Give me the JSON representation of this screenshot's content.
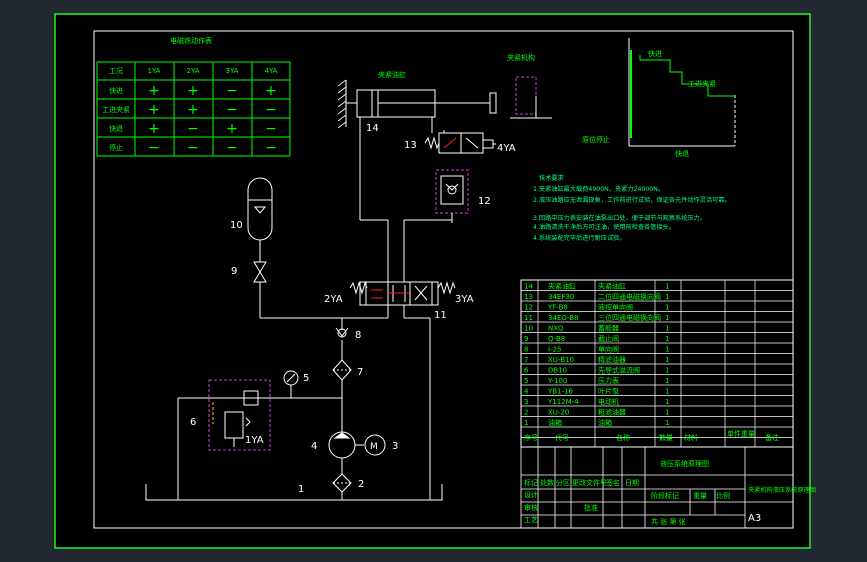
{
  "sheet_size": "A3",
  "colors": {
    "background": "#212830",
    "paper": "#000000",
    "frame": "#26ff32",
    "line": "#ffffff",
    "table": "#00ff00",
    "magenta": "#d43fd4",
    "red": "#ff2020",
    "yellow": "#ffcc00",
    "note": "#00ff88"
  },
  "electromagnet_table": {
    "title": "电磁铁动作表",
    "header": [
      "工况",
      "1YA",
      "2YA",
      "3YA",
      "4YA"
    ],
    "rows": [
      [
        "快进",
        "+",
        "+",
        "−",
        "+"
      ],
      [
        "工进夹紧",
        "+",
        "+",
        "−",
        "−"
      ],
      [
        "快退",
        "+",
        "−",
        "+",
        "−"
      ],
      [
        "停止",
        "−",
        "−",
        "−",
        "−"
      ]
    ]
  },
  "component_labels": {
    "clamp_cylinder": "夹紧油缸",
    "clamp_mechanism": "夹紧机构",
    "c14": "14",
    "c13": "13",
    "ya4": "4YA",
    "c12": "12",
    "c10": "10",
    "c9": "9",
    "c8": "8",
    "c7": "7",
    "c6": "6",
    "c5": "5",
    "c4": "4",
    "c3": "3",
    "c2": "2",
    "c1": "1",
    "c11": "11",
    "ya2": "2YA",
    "ya3": "3YA",
    "ya1": "1YA",
    "motor": "M"
  },
  "motion_graph": {
    "fast_forward": "快进",
    "work_feed": "工进夹紧",
    "stop": "原位停止",
    "fast_back": "快退"
  },
  "tech_notes": {
    "title": "技术要求",
    "lines": [
      "1.夹紧油缸最大载荷4900N，夹紧力24000N。",
      "2.液压油路应无泄漏现象，工作前进行试验，保证各元件动作灵活可靠。",
      "3.回路中压力表安装在油泵出口处，便于调节与观察系统压力。",
      "4.油路清洗干净后方可注油，使用前检查各管接头。",
      "4.系统装配完毕后进行耐压试验。"
    ]
  },
  "parts_list": [
    [
      "14",
      "夹紧油缸",
      "夹紧油缸",
      "1"
    ],
    [
      "13",
      "34EF30",
      "二位四通电磁换向阀",
      "1"
    ],
    [
      "12",
      "YF-B8",
      "液控单向阀",
      "1"
    ],
    [
      "11",
      "34EO-B8",
      "三位四通电磁换向阀",
      "1"
    ],
    [
      "10",
      "NXQ",
      "蓄能器",
      "1"
    ],
    [
      "9",
      "Q-B8",
      "截止阀",
      "1"
    ],
    [
      "8",
      "I-25",
      "单向阀",
      "1"
    ],
    [
      "7",
      "XU-B10",
      "精滤油器",
      "1"
    ],
    [
      "6",
      "DB10",
      "先导式溢流阀",
      "1"
    ],
    [
      "5",
      "Y-100",
      "压力表",
      "1"
    ],
    [
      "4",
      "YB1-16",
      "叶片泵",
      "1"
    ],
    [
      "3",
      "Y112M-4",
      "电动机",
      "1"
    ],
    [
      "2",
      "XU-20",
      "粗滤油器",
      "1"
    ],
    [
      "1",
      "油箱",
      "油箱",
      "1"
    ]
  ],
  "parts_header": [
    "序号",
    "代号",
    "名称",
    "数量",
    "材料",
    "单件重量",
    "备注"
  ],
  "title_block": {
    "drawing_name": "液压系统原理图",
    "project": "夹紧机构液压系统原理图",
    "scale_label": "比例",
    "sheet_label": "共  张  第  张",
    "labels": [
      "设计",
      "审核",
      "工艺",
      "批准",
      "标记",
      "处数",
      "分区",
      "更改文件号",
      "签名",
      "日期",
      "阶段标记",
      "重量"
    ]
  }
}
